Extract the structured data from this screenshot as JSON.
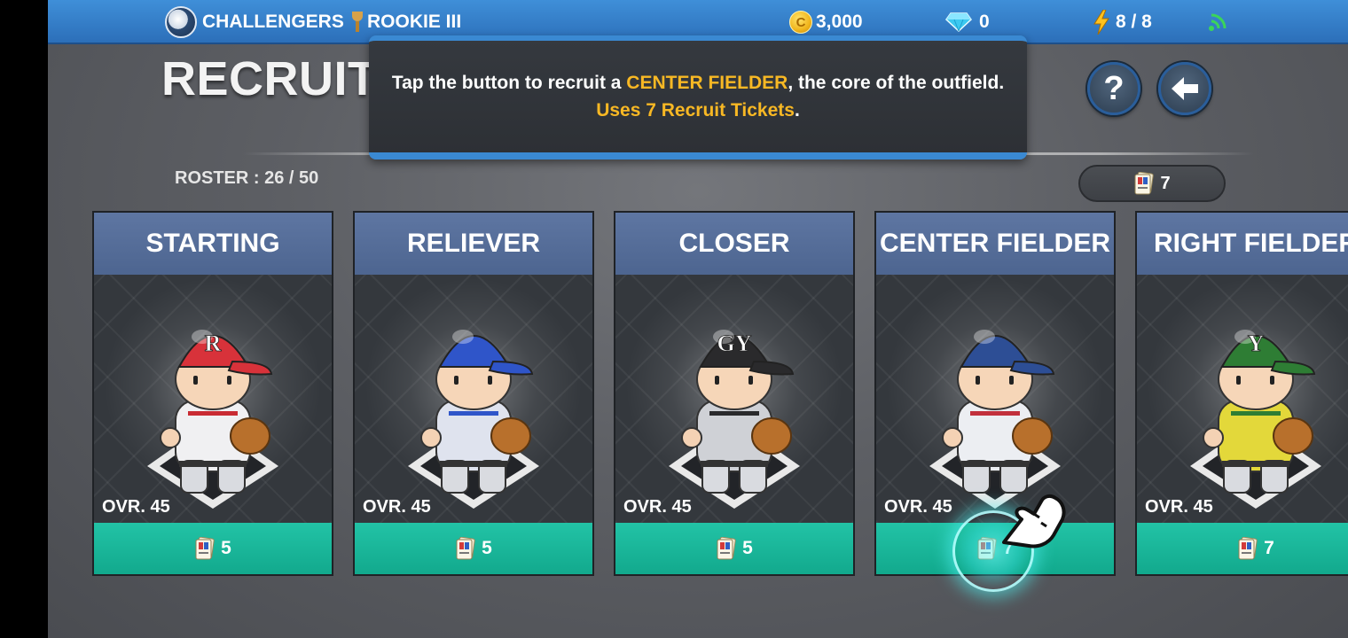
{
  "topbar": {
    "team_name": "CHALLENGERS",
    "rank": "ROOKIE III",
    "coins": "3,000",
    "gems": "0",
    "energy": "8 / 8",
    "coin_symbol": "C"
  },
  "header": {
    "title": "RECRUIT",
    "roster": "ROSTER : 26 / 50",
    "help_label": "?",
    "ticket_count": "7"
  },
  "tooltip": {
    "line1_before": "Tap the button to recruit a ",
    "line1_highlight": "CENTER FIELDER",
    "line1_after": ", the core of the outfield.",
    "line2_highlight": "Uses 7 Recruit Tickets",
    "line2_after": "."
  },
  "cards": [
    {
      "title": "STARTING",
      "ovr": "OVR. 45",
      "cost": "5",
      "cap_color": "#d8323a",
      "cap_letter": "R",
      "jersey_color": "#f0f0f2",
      "accent": "#c92b33"
    },
    {
      "title": "RELIEVER",
      "ovr": "OVR. 45",
      "cost": "5",
      "cap_color": "#2f55c9",
      "cap_letter": "",
      "jersey_color": "#dfe3ee",
      "accent": "#2f55c9"
    },
    {
      "title": "CLOSER",
      "ovr": "OVR. 45",
      "cost": "5",
      "cap_color": "#2a2a2c",
      "cap_letter": "GY",
      "jersey_color": "#cfd1d6",
      "accent": "#2a2a2c"
    },
    {
      "title": "CENTER FIELDER",
      "ovr": "OVR. 45",
      "cost": "7",
      "cap_color": "#2d4e95",
      "cap_letter": "",
      "jersey_color": "#eceef2",
      "accent": "#c2303c"
    },
    {
      "title": "RIGHT FIELDER",
      "ovr": "OVR. 45",
      "cost": "7",
      "cap_color": "#2e7d34",
      "cap_letter": "Y",
      "jersey_color": "#e3d83a",
      "accent": "#2e7d34"
    }
  ],
  "icons": [
    "team-logo",
    "trophy-icon",
    "coin-icon",
    "diamond-icon",
    "bolt-icon",
    "wifi-icon",
    "help-icon",
    "back-arrow-icon",
    "ticket-icon",
    "hand-pointer-icon"
  ],
  "colors": {
    "topbar": "#2c6fb9",
    "accent_yellow": "#f8b824",
    "card_header": "#5e76a2",
    "recruit_button": "#17b59a"
  }
}
